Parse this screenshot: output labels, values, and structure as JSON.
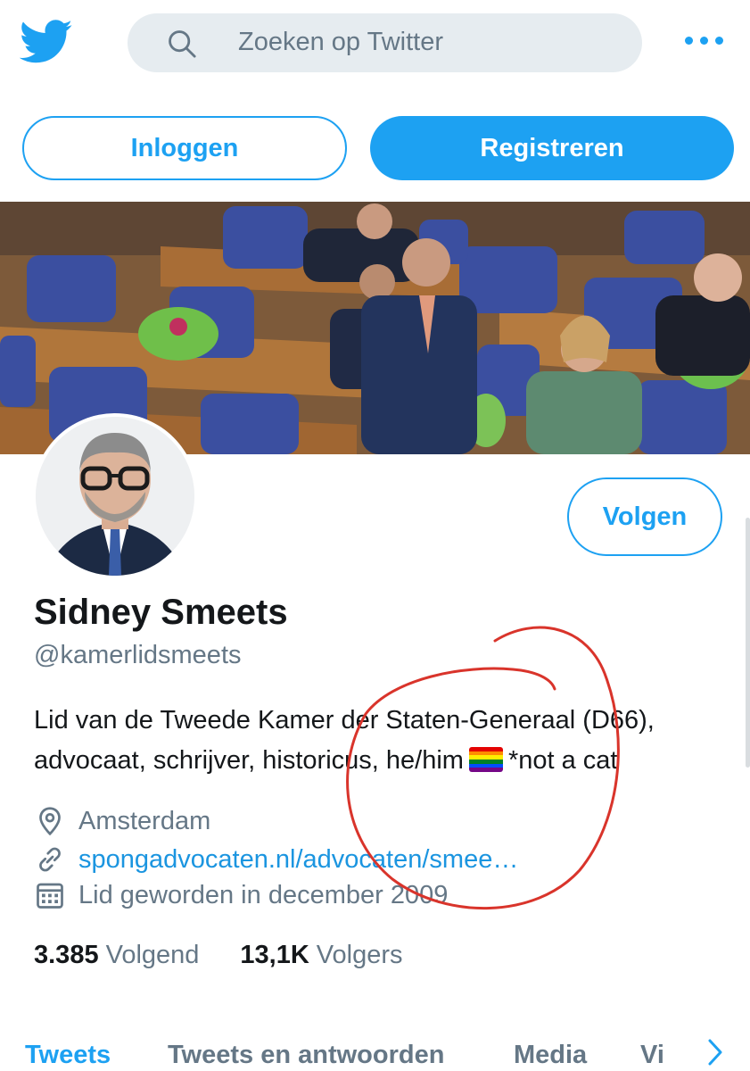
{
  "header": {
    "search_placeholder": "Zoeken op Twitter"
  },
  "auth": {
    "login_label": "Inloggen",
    "register_label": "Registreren"
  },
  "profile": {
    "follow_label": "Volgen",
    "name": "Sidney Smeets",
    "handle": "@kamerlidsmeets",
    "bio_line1": "Lid van de Tweede Kamer der Staten-Generaal (D66),",
    "bio_line2_a": "advocaat, schrijver, historicus, he/him",
    "bio_line2_b": "*not a cat",
    "location": "Amsterdam",
    "website": "spongadvocaten.nl/advocaten/smee…",
    "joined": "Lid geworden in december 2009"
  },
  "stats": {
    "following_count": "3.385",
    "following_label": "Volgend",
    "followers_count": "13,1K",
    "followers_label": "Volgers"
  },
  "tabs": [
    {
      "label": "Tweets"
    },
    {
      "label": "Tweets en antwoorden"
    },
    {
      "label": "Media"
    },
    {
      "label": "Vi"
    }
  ],
  "colors": {
    "accent": "#1da1f2",
    "annotation": "#d9342b"
  }
}
